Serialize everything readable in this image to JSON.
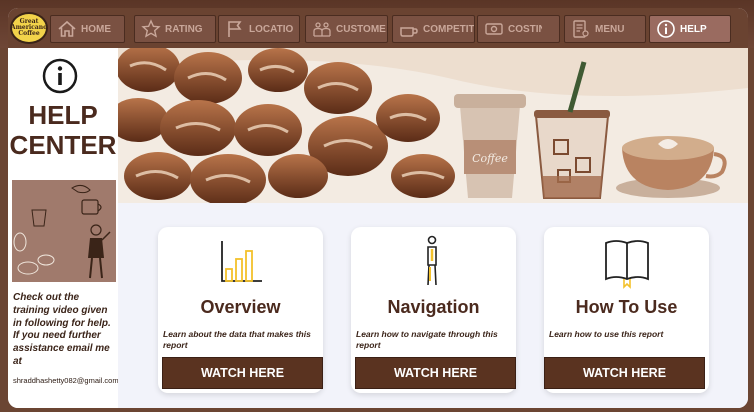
{
  "logo": {
    "text": "Great Americano Coffee"
  },
  "nav": {
    "items": [
      {
        "label": "HOME",
        "icon": "home-icon"
      },
      {
        "label": "RATING",
        "icon": "star-icon"
      },
      {
        "label": "LOCATION",
        "icon": "flag-icon"
      },
      {
        "label": "CUSTOMER",
        "icon": "people-icon"
      },
      {
        "label": "COMPETITOR",
        "icon": "cup-icon"
      },
      {
        "label": "COSTING",
        "icon": "money-icon"
      },
      {
        "label": "MENU",
        "icon": "menu-icon"
      },
      {
        "label": "HELP",
        "icon": "info-icon"
      }
    ],
    "active": "HELP"
  },
  "sidebar": {
    "title": "HELP CENTER",
    "message": "Check out the training video given in following for help. If you need further assistance email me at",
    "email": "shraddhashetty082@gmail.com"
  },
  "banner": {
    "cup_text": "Coffee"
  },
  "cards": [
    {
      "title": "Overview",
      "desc": "Learn about the data that makes this report",
      "button": "WATCH HERE",
      "icon": "bar-chart-icon"
    },
    {
      "title": "Navigation",
      "desc": "Learn how to navigate through this report",
      "button": "WATCH HERE",
      "icon": "person-icon"
    },
    {
      "title": "How To Use",
      "desc": "Learn how to use this report",
      "button": "WATCH HERE",
      "icon": "book-icon"
    }
  ],
  "colors": {
    "brand": "#6a4331",
    "button": "#5a3320",
    "accent": "#f2d34a"
  }
}
